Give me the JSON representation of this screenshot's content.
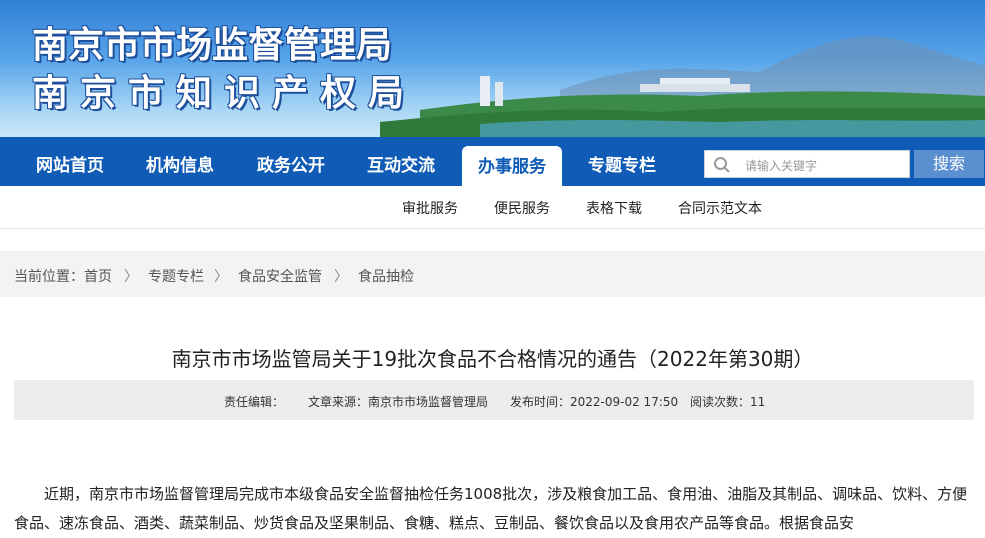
{
  "header": {
    "title_line1": "南京市市场监督管理局",
    "title_line2": "南京市知识产权局"
  },
  "nav": {
    "items": [
      "网站首页",
      "机构信息",
      "政务公开",
      "互动交流",
      "办事服务",
      "专题专栏"
    ],
    "active": "办事服务",
    "search_placeholder": "请输入关键字",
    "search_button": "搜索"
  },
  "subnav": {
    "items": [
      "审批服务",
      "便民服务",
      "表格下载",
      "合同示范文本"
    ]
  },
  "breadcrumb": {
    "prefix": "当前位置：",
    "items": [
      "首页",
      "专题专栏",
      "食品安全监管",
      "食品抽检"
    ],
    "separator": "〉"
  },
  "article": {
    "title": "南京市市场监管局关于19批次食品不合格情况的通告（2022年第30期）",
    "editor_label": "责任编辑：",
    "source": "文章来源：南京市市场监督管理局",
    "published": "发布时间：2022-09-02 17:50",
    "views": "阅读次数：11",
    "body": "近期，南京市市场监督管理局完成市本级食品安全监督抽检任务1008批次，涉及粮食加工品、食用油、油脂及其制品、调味品、饮料、方便食品、速冻食品、酒类、蔬菜制品、炒货食品及坚果制品、食糖、糕点、豆制品、餐饮食品以及食用农产品等食品。根据食品安"
  },
  "colors": {
    "nav_bg": "#0f5bb5",
    "search_button": "#5a8fd0",
    "breadcrumb_bg": "#f3f3f3"
  }
}
